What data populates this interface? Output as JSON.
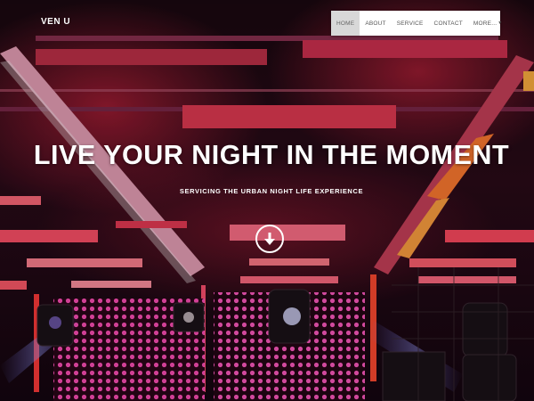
{
  "brand": {
    "name": "VEN U"
  },
  "nav": {
    "items": [
      {
        "label": "HOME",
        "active": true
      },
      {
        "label": "ABOUT",
        "active": false
      },
      {
        "label": "SERVICE",
        "active": false
      },
      {
        "label": "CONTACT",
        "active": false
      },
      {
        "label": "MORE...",
        "active": false,
        "has_dropdown": true
      }
    ]
  },
  "hero": {
    "title": "LIVE YOUR NIGHT IN THE MOMENT",
    "subtitle": "SERVICING THE URBAN NIGHT LIFE EXPERIENCE",
    "scroll_icon": "arrow-down-icon"
  },
  "colors": {
    "accent_red": "#ff2a4a",
    "accent_magenta": "#e0307a",
    "nav_bg": "#ffffff",
    "nav_active_bg": "#d8d8d8",
    "text": "#ffffff"
  }
}
